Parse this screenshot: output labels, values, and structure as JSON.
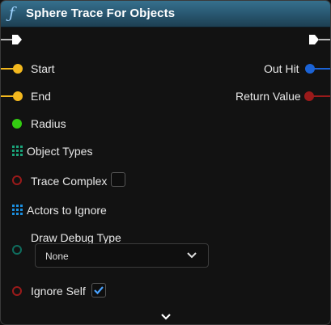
{
  "node": {
    "title": "Sphere Trace For Objects",
    "title_icon": "function-icon",
    "header_color": "#2a5a74"
  },
  "inputs": {
    "start": "Start",
    "end": "End",
    "radius": "Radius",
    "object_types": "Object Types",
    "trace_complex": "Trace Complex",
    "actors_to_ignore": "Actors to Ignore",
    "draw_debug_type": "Draw Debug Type",
    "ignore_self": "Ignore Self"
  },
  "outputs": {
    "out_hit": "Out Hit",
    "return_value": "Return Value"
  },
  "values": {
    "trace_complex_checked": false,
    "draw_debug_type_selected": "None",
    "ignore_self_checked": true
  },
  "colors": {
    "vector_pin": "#f3b81e",
    "float_pin": "#33cc11",
    "struct_pin": "#1b63d6",
    "bool_pin": "#9a1a1a",
    "array_pin": "#1aa37a",
    "actor_array_pin": "#1b8fe0",
    "enum_pin": "#0f6d5e",
    "checkbox_check": "#4aa3ff"
  },
  "icons": {
    "exec_in": "exec-pin-icon",
    "exec_out": "exec-pin-icon",
    "dropdown": "chevron-down-icon",
    "advanced": "chevron-down-icon"
  }
}
